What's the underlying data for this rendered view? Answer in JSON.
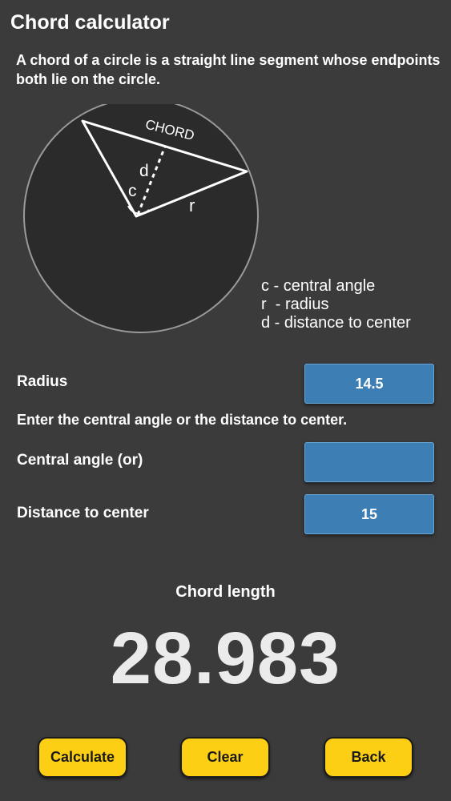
{
  "header": {
    "title": "Chord calculator",
    "description": "A chord of a circle is a straight line segment whose endpoints both lie on the circle."
  },
  "diagram": {
    "chord_label": "CHORD",
    "c_label": "c",
    "d_label": "d",
    "r_label": "r"
  },
  "legend": {
    "items": [
      "c - central angle",
      "r  - radius",
      "d - distance to center"
    ]
  },
  "form": {
    "radius_label": "Radius",
    "radius_value": "14.5",
    "hint": "Enter the central angle or the distance to center.",
    "angle_label": "Central angle (or)",
    "angle_value": "",
    "distance_label": "Distance to center",
    "distance_value": "15"
  },
  "result": {
    "label": "Chord length",
    "value": "28.983"
  },
  "buttons": {
    "calculate": "Calculate",
    "clear": "Clear",
    "back": "Back"
  },
  "colors": {
    "background": "#3b3b3c",
    "field": "#3d7fb4",
    "button": "#fccf14",
    "circle_fill": "#2b2b2c",
    "circle_stroke": "#9a9a9a"
  }
}
